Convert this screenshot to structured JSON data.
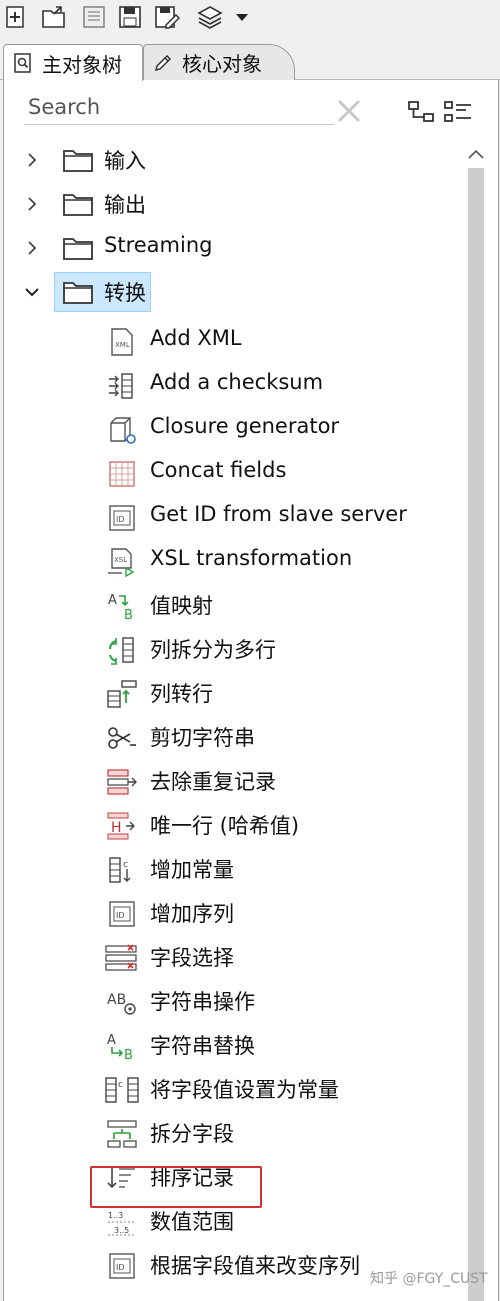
{
  "toolbar": {
    "buttons": [
      {
        "name": "new-icon"
      },
      {
        "name": "open-folder-icon"
      },
      {
        "name": "explore-repository-icon"
      },
      {
        "name": "save-icon"
      },
      {
        "name": "save-as-icon"
      },
      {
        "name": "layers-icon"
      },
      {
        "name": "dropdown-arrow-icon"
      }
    ]
  },
  "tabs": [
    {
      "label": "主对象树",
      "icon": "search-doc-icon",
      "active": true
    },
    {
      "label": "核心对象",
      "icon": "pencil-icon",
      "active": false
    }
  ],
  "search": {
    "placeholder": "Search",
    "value": ""
  },
  "tree": {
    "folders": [
      {
        "label": "输入",
        "expanded": false
      },
      {
        "label": "输出",
        "expanded": false
      },
      {
        "label": "Streaming",
        "expanded": false
      },
      {
        "label": "转换",
        "expanded": true,
        "selected": true
      }
    ],
    "steps": [
      {
        "label": "Add XML",
        "icon": "xml-icon"
      },
      {
        "label": "Add a checksum",
        "icon": "checksum-icon"
      },
      {
        "label": "Closure generator",
        "icon": "closure-icon"
      },
      {
        "label": "Concat fields",
        "icon": "grid-icon"
      },
      {
        "label": "Get ID from slave server",
        "icon": "id-icon"
      },
      {
        "label": "XSL transformation",
        "icon": "xsl-icon"
      },
      {
        "label": "值映射",
        "icon": "value-mapper-icon"
      },
      {
        "label": "列拆分为多行",
        "icon": "split-rows-icon"
      },
      {
        "label": "列转行",
        "icon": "column-to-row-icon"
      },
      {
        "label": "剪切字符串",
        "icon": "scissors-icon"
      },
      {
        "label": "去除重复记录",
        "icon": "dedupe-icon"
      },
      {
        "label": "唯一行 (哈希值)",
        "icon": "unique-hash-icon"
      },
      {
        "label": "增加常量",
        "icon": "add-constant-icon"
      },
      {
        "label": "增加序列",
        "icon": "sequence-icon"
      },
      {
        "label": "字段选择",
        "icon": "select-fields-icon"
      },
      {
        "label": "字符串操作",
        "icon": "string-ops-icon"
      },
      {
        "label": "字符串替换",
        "icon": "string-replace-icon"
      },
      {
        "label": "将字段值设置为常量",
        "icon": "set-constant-icon"
      },
      {
        "label": "拆分字段",
        "icon": "split-fields-icon"
      },
      {
        "label": "排序记录",
        "icon": "sort-icon",
        "highlighted": true
      },
      {
        "label": "数值范围",
        "icon": "number-range-icon"
      },
      {
        "label": "根据字段值来改变序列",
        "icon": "change-sequence-icon"
      }
    ]
  },
  "watermark": "知乎 @FGY_CUST",
  "colors": {
    "selection": "#cce8ff",
    "highlight_border": "#d03030",
    "icon_green": "#2aa33f",
    "icon_red": "#d32f2f"
  }
}
